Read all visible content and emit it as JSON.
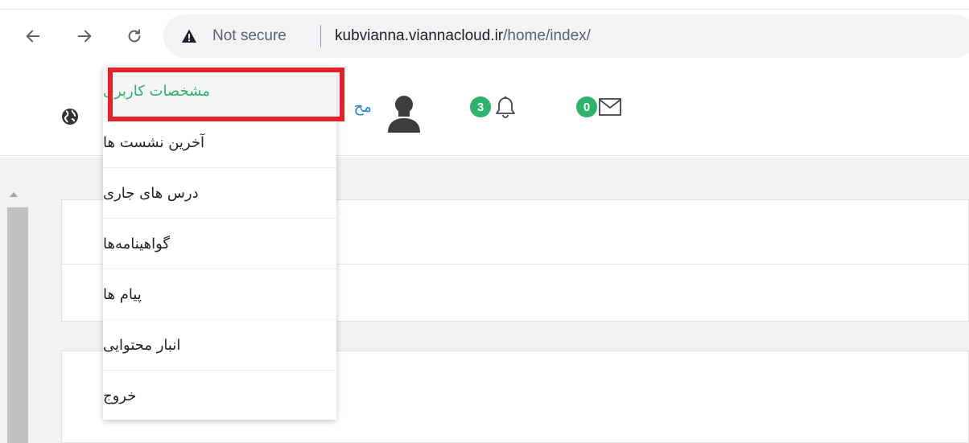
{
  "browser": {
    "security_label": "Not secure",
    "url_host": "kubvianna.viannacloud.ir",
    "url_path": "/home/index/"
  },
  "header": {
    "username_partial": "مح",
    "notifications_count": "3",
    "messages_count": "0"
  },
  "dropdown": {
    "items": [
      {
        "label": "مشخصات کاربری",
        "active": true
      },
      {
        "label": "آخرین نشست ها"
      },
      {
        "label": "درس های جاری"
      },
      {
        "label": "گواهینامه‌ها"
      },
      {
        "label": "پیام ها"
      },
      {
        "label": "انبار محتوایی"
      },
      {
        "label": "خروج"
      }
    ]
  },
  "colors": {
    "accent_green": "#2db36b",
    "highlight_red": "#e52129",
    "link_blue": "#1e88e5"
  }
}
